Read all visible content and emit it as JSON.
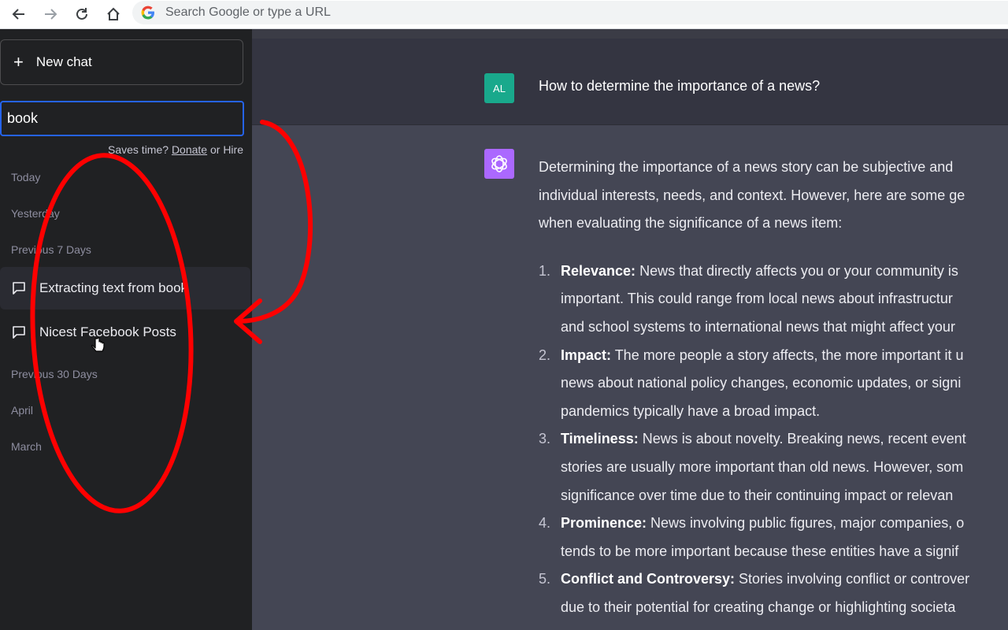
{
  "browser": {
    "omnibox_placeholder": "Search Google or type a URL"
  },
  "sidebar": {
    "new_chat_label": "New chat",
    "search_value": "book",
    "promo_prefix": "Saves time? ",
    "promo_donate": "Donate",
    "promo_suffix": " or Hire",
    "sections": {
      "today": "Today",
      "yesterday": "Yesterday",
      "previous_7": "Previous 7 Days",
      "previous_30": "Previous 30 Days",
      "april": "April",
      "march": "March"
    },
    "conversations": [
      {
        "title": "Extracting text from book"
      },
      {
        "title": "Nicest Facebook Posts"
      }
    ]
  },
  "main": {
    "user_initials": "AL",
    "user_message": "How to determine the importance of a news?",
    "intro_lines": [
      "Determining the importance of a news story can be subjective and",
      "individual interests, needs, and context. However, here are some ge",
      "when evaluating the significance of a news item:"
    ],
    "items": [
      {
        "num": "1.",
        "term": "Relevance:",
        "line1": " News that directly affects you or your community is",
        "line2": "important. This could range from local news about infrastructur",
        "line3": "and school systems to international news that might affect your"
      },
      {
        "num": "2.",
        "term": "Impact:",
        "line1": " The more people a story affects, the more important it u",
        "line2": "news about national policy changes, economic updates, or signi",
        "line3": "pandemics typically have a broad impact."
      },
      {
        "num": "3.",
        "term": "Timeliness:",
        "line1": " News is about novelty. Breaking news, recent event",
        "line2": "stories are usually more important than old news. However, som",
        "line3": "significance over time due to their continuing impact or relevan"
      },
      {
        "num": "4.",
        "term": "Prominence:",
        "line1": " News involving public figures, major companies, o",
        "line2": "tends to be more important because these entities have a signif"
      },
      {
        "num": "5.",
        "term": "Conflict and Controversy:",
        "line1": " Stories involving conflict or controver",
        "line2": "due to their potential for creating change or highlighting societa"
      }
    ]
  },
  "colors": {
    "sidebar_bg": "#202123",
    "main_bg": "#343541",
    "assistant_bg": "#444654",
    "user_avatar": "#19a98c",
    "gpt_avatar": "#ab68ff",
    "search_focus": "#2563eb",
    "annotation_red": "#ff0000"
  }
}
